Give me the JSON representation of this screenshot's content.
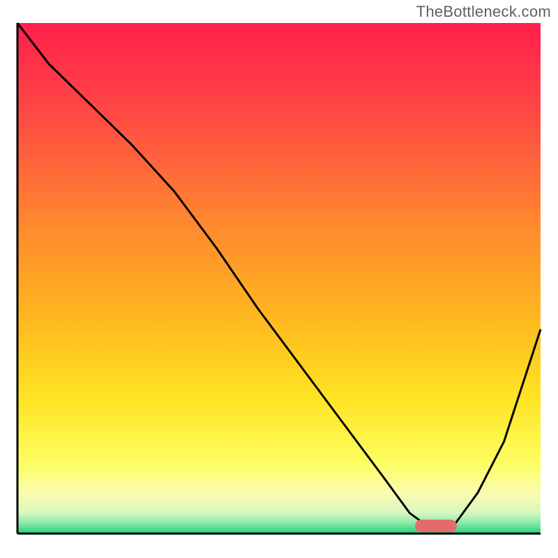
{
  "watermark": "TheBottleneck.com",
  "colors": {
    "curve": "#000000",
    "axis": "#000000",
    "marker": "#e66a6a",
    "gradient_stops": [
      {
        "offset": "0%",
        "color": "#ff1f4b"
      },
      {
        "offset": "18%",
        "color": "#ff4a44"
      },
      {
        "offset": "40%",
        "color": "#ff8a2e"
      },
      {
        "offset": "58%",
        "color": "#ffb81f"
      },
      {
        "offset": "74%",
        "color": "#ffe524"
      },
      {
        "offset": "86%",
        "color": "#fdfd60"
      },
      {
        "offset": "92%",
        "color": "#fbfcb0"
      },
      {
        "offset": "96%",
        "color": "#d6f7c0"
      },
      {
        "offset": "98%",
        "color": "#86e9a8"
      },
      {
        "offset": "100%",
        "color": "#21d07a"
      }
    ]
  },
  "chart_data": {
    "type": "line",
    "title": "",
    "xlabel": "",
    "ylabel": "",
    "xlim": [
      0,
      100
    ],
    "ylim": [
      0,
      100
    ],
    "series": [
      {
        "name": "bottleneck-curve",
        "x": [
          0,
          6,
          14,
          22,
          30,
          38,
          46,
          54,
          62,
          70,
          75,
          79,
          83,
          88,
          93,
          100
        ],
        "y": [
          100,
          92,
          84,
          76,
          67,
          56,
          44,
          33,
          22,
          11,
          4,
          1,
          1,
          8,
          18,
          40
        ]
      }
    ],
    "optimal_range_x": [
      76,
      84
    ],
    "annotations": []
  }
}
